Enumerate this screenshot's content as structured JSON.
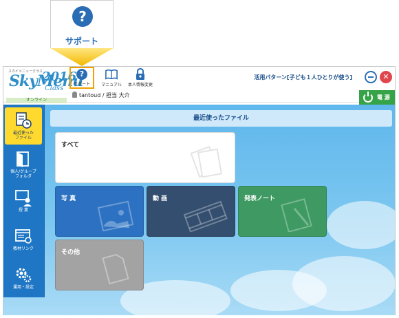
{
  "callout": {
    "icon": "question-icon",
    "label": "サポート",
    "glyph": "?"
  },
  "header": {
    "logo_small": "スカイメニュークラス",
    "logo_main": "SkyMenu",
    "logo_year": "2016",
    "logo_class": "Class",
    "tools": [
      {
        "icon": "question-icon",
        "label": "サポート",
        "glyph": "?"
      },
      {
        "icon": "book-icon",
        "label": "マニュアル"
      },
      {
        "icon": "lock-icon",
        "label": "本人情報変更"
      }
    ],
    "mode_text": "活用パターン[子ども１人ひとりが使う]",
    "close_glyph": "✕"
  },
  "status": {
    "online": "オンライン",
    "user": "tantoud / 担当 大介",
    "power_label": "電 源"
  },
  "sidebar": {
    "items": [
      {
        "icon": "recent-files-icon",
        "label": "最近使った\nファイル",
        "active": true
      },
      {
        "icon": "folder-icon",
        "label": "個人/グループ\nフォルダ",
        "active": false
      },
      {
        "icon": "classroom-icon",
        "label": "授 業",
        "active": false
      },
      {
        "icon": "link-icon",
        "label": "教材リンク",
        "active": false
      },
      {
        "icon": "gear-icon",
        "label": "運用・設定",
        "active": false
      }
    ]
  },
  "main": {
    "title": "最近使ったファイル",
    "tiles": [
      {
        "label": "すべて",
        "icon": "files-icon"
      },
      {
        "label": "写 真",
        "icon": "photo-icon"
      },
      {
        "label": "動 画",
        "icon": "film-icon"
      },
      {
        "label": "発表ノート",
        "icon": "notebook-icon"
      },
      {
        "label": "その他",
        "icon": "document-icon"
      }
    ]
  },
  "colors": {
    "accent": "#2a6db5",
    "callout_highlight": "#f0a000",
    "active_nav": "#ffd92e",
    "power": "#37a348",
    "close": "#e0464d"
  }
}
